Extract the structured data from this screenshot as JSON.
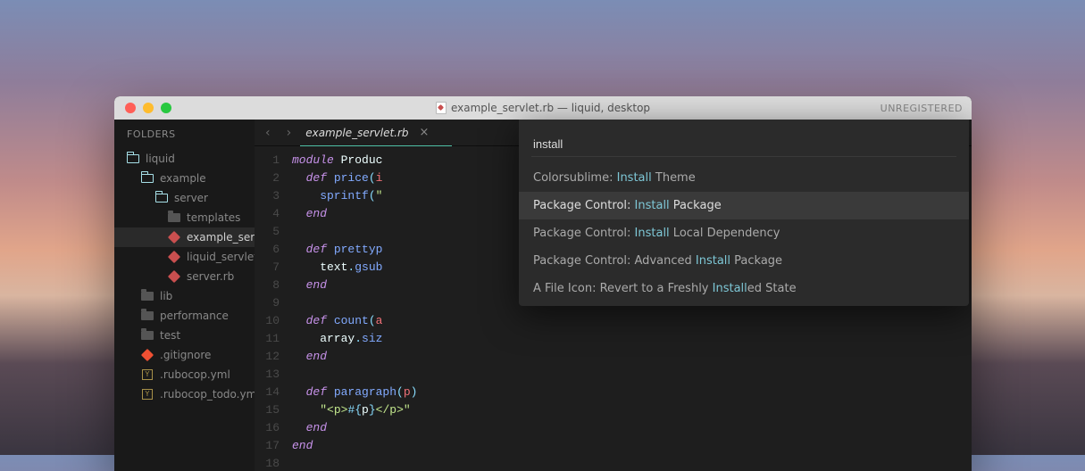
{
  "titlebar": {
    "title_file": "example_servlet.rb",
    "title_suffix": " — liquid, desktop",
    "unregistered": "UNREGISTERED"
  },
  "sidebar": {
    "header": "FOLDERS",
    "items": [
      {
        "label": "liquid",
        "icon": "folder-open",
        "depth": 1
      },
      {
        "label": "example",
        "icon": "folder-open",
        "depth": 2
      },
      {
        "label": "server",
        "icon": "folder-open",
        "depth": 3
      },
      {
        "label": "templates",
        "icon": "folder-closed",
        "depth": 4
      },
      {
        "label": "example_servl",
        "icon": "ruby",
        "depth": 4,
        "selected": true
      },
      {
        "label": "liquid_servlet.",
        "icon": "ruby",
        "depth": 4
      },
      {
        "label": "server.rb",
        "icon": "ruby",
        "depth": 4
      },
      {
        "label": "lib",
        "icon": "folder-closed",
        "depth": 2
      },
      {
        "label": "performance",
        "icon": "folder-closed",
        "depth": 2
      },
      {
        "label": "test",
        "icon": "folder-closed",
        "depth": 2
      },
      {
        "label": ".gitignore",
        "icon": "git",
        "depth": 2
      },
      {
        "label": ".rubocop.yml",
        "icon": "yml",
        "depth": 2
      },
      {
        "label": ".rubocop_todo.yml",
        "icon": "yml",
        "depth": 2
      }
    ]
  },
  "tab": {
    "name": "example_servlet.rb",
    "close": "×"
  },
  "nav": {
    "back": "‹",
    "forward": "›",
    "more": "⋮"
  },
  "code": {
    "lines": [
      {
        "n": "1",
        "tokens": [
          {
            "t": "module ",
            "c": "kw"
          },
          {
            "t": "Produc",
            "c": "mname"
          }
        ]
      },
      {
        "n": "2",
        "tokens": [
          {
            "t": "  ",
            "c": ""
          },
          {
            "t": "def ",
            "c": "def"
          },
          {
            "t": "price",
            "c": "fn"
          },
          {
            "t": "(",
            "c": "punc"
          },
          {
            "t": "i",
            "c": "param"
          }
        ]
      },
      {
        "n": "3",
        "tokens": [
          {
            "t": "    sprintf",
            "c": "fn"
          },
          {
            "t": "(",
            "c": "punc"
          },
          {
            "t": "\"",
            "c": "str"
          }
        ]
      },
      {
        "n": "4",
        "tokens": [
          {
            "t": "  ",
            "c": ""
          },
          {
            "t": "end",
            "c": "kw"
          }
        ]
      },
      {
        "n": "5",
        "tokens": []
      },
      {
        "n": "6",
        "tokens": [
          {
            "t": "  ",
            "c": ""
          },
          {
            "t": "def ",
            "c": "def"
          },
          {
            "t": "prettyp",
            "c": "fn"
          }
        ]
      },
      {
        "n": "7",
        "tokens": [
          {
            "t": "    text",
            "c": "mname"
          },
          {
            "t": ".",
            "c": "punc"
          },
          {
            "t": "gsub",
            "c": "fn"
          }
        ]
      },
      {
        "n": "8",
        "tokens": [
          {
            "t": "  ",
            "c": ""
          },
          {
            "t": "end",
            "c": "kw"
          }
        ]
      },
      {
        "n": "9",
        "tokens": []
      },
      {
        "n": "10",
        "tokens": [
          {
            "t": "  ",
            "c": ""
          },
          {
            "t": "def ",
            "c": "def"
          },
          {
            "t": "count",
            "c": "fn"
          },
          {
            "t": "(",
            "c": "punc"
          },
          {
            "t": "a",
            "c": "param"
          }
        ]
      },
      {
        "n": "11",
        "tokens": [
          {
            "t": "    array",
            "c": "mname"
          },
          {
            "t": ".",
            "c": "punc"
          },
          {
            "t": "siz",
            "c": "fn"
          }
        ]
      },
      {
        "n": "12",
        "tokens": [
          {
            "t": "  ",
            "c": ""
          },
          {
            "t": "end",
            "c": "kw"
          }
        ]
      },
      {
        "n": "13",
        "tokens": []
      },
      {
        "n": "14",
        "tokens": [
          {
            "t": "  ",
            "c": ""
          },
          {
            "t": "def ",
            "c": "def"
          },
          {
            "t": "paragraph",
            "c": "fn"
          },
          {
            "t": "(",
            "c": "punc"
          },
          {
            "t": "p",
            "c": "param"
          },
          {
            "t": ")",
            "c": "punc"
          }
        ]
      },
      {
        "n": "15",
        "tokens": [
          {
            "t": "    ",
            "c": ""
          },
          {
            "t": "\"<p>",
            "c": "str"
          },
          {
            "t": "#{",
            "c": "inter"
          },
          {
            "t": "p",
            "c": "mname"
          },
          {
            "t": "}",
            "c": "inter"
          },
          {
            "t": "</p>\"",
            "c": "str"
          }
        ]
      },
      {
        "n": "16",
        "tokens": [
          {
            "t": "  ",
            "c": ""
          },
          {
            "t": "end",
            "c": "kw"
          }
        ]
      },
      {
        "n": "17",
        "tokens": [
          {
            "t": "end",
            "c": "kw"
          }
        ]
      },
      {
        "n": "18",
        "tokens": []
      }
    ]
  },
  "palette": {
    "query": "install",
    "items": [
      {
        "prefix": "Colorsublime: ",
        "hl": "Install",
        "suffix": " Theme"
      },
      {
        "prefix": "Package Control: ",
        "hl": "Install",
        "suffix": " Package",
        "selected": true
      },
      {
        "prefix": "Package Control: ",
        "hl": "Install",
        "suffix": " Local Dependency"
      },
      {
        "prefix": "Package Control: Advanced ",
        "hl": "Install",
        "suffix": " Package"
      },
      {
        "prefix": "A File Icon: Revert to a Freshly ",
        "hl": "Install",
        "suffix": "ed State"
      }
    ]
  }
}
